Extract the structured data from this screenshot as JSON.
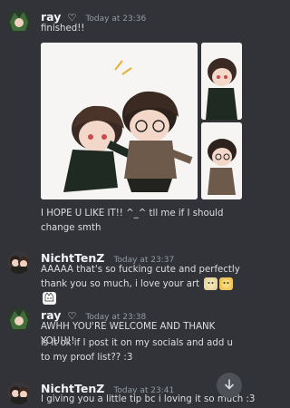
{
  "messages": [
    {
      "author": "ray",
      "heart": "♡",
      "time": "Today at 23:36",
      "lines": [
        "finished!!"
      ],
      "after_image": "I HOPE U LIKE IT!! ^_^ tll me if I should change smth"
    },
    {
      "author": "NichtTenZ",
      "time": "Today at 23:37",
      "text": "AAAAA that's so fucking cute and perfectly thank you so much, i love your art"
    },
    {
      "author": "ray",
      "heart": "♡",
      "time": "Today at 23:38",
      "text": "AWHH YOU'RE WELCOME AND THANK YOU!!!!",
      "text2": "is it ok if I post it on my socials and add u to my proof list?? :3"
    },
    {
      "author": "NichtTenZ",
      "time": "Today at 23:41",
      "text": "I giving you a little tip bc i loving it so much :3"
    }
  ],
  "emotes": [
    "dog-emoji",
    "dog-emoji",
    "cat-emoji"
  ],
  "icons": {
    "scroll": "arrow-down-icon"
  }
}
